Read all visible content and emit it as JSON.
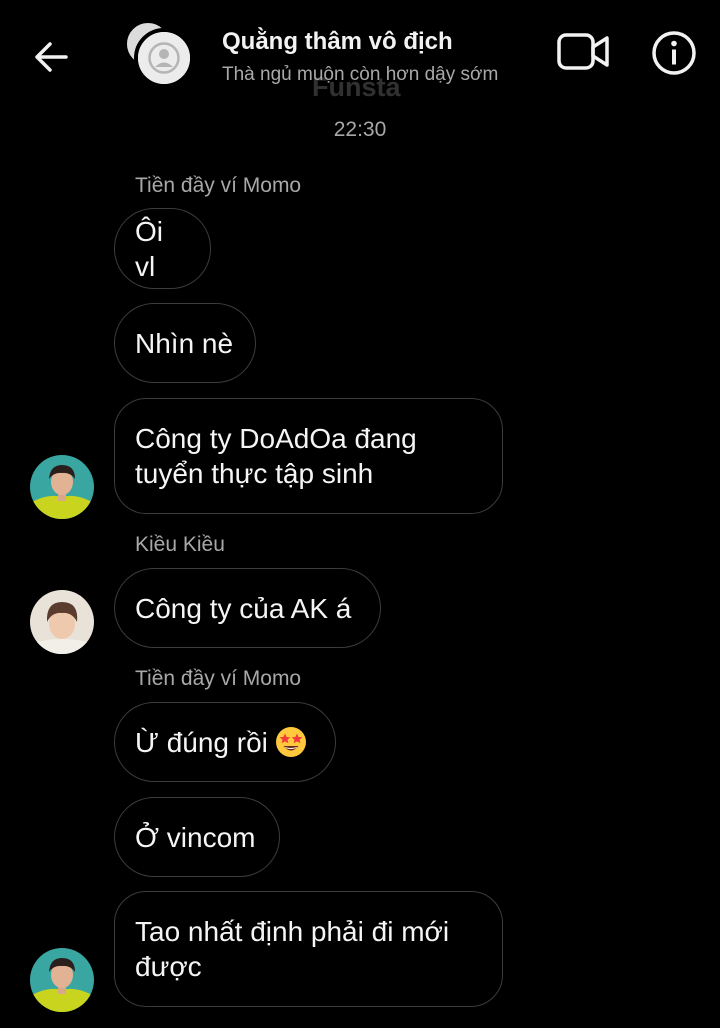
{
  "header": {
    "title": "Quằng thâm vô địch",
    "status": "Thà ngủ muộn còn hơn dậy sớm",
    "watermark": "Funsta",
    "back_icon": "arrow-left-icon",
    "video_icon": "video-camera-icon",
    "info_icon": "info-icon"
  },
  "timestamp": "22:30",
  "colors": {
    "background": "#000000",
    "bubble_border": "#3c3c3c",
    "secondary_text": "#a8a8a8",
    "primary_text": "#f5f5f5"
  },
  "messages": [
    {
      "sender": "Tiền đầy ví Momo",
      "text": "Ôi vl"
    },
    {
      "text": "Nhìn nè"
    },
    {
      "lines": [
        "Công ty DoAdOa đang",
        "tuyển thực tập sinh"
      ]
    },
    {
      "sender": "Kiều Kiều",
      "text": "Công ty của AK á"
    },
    {
      "sender": "Tiền đầy ví Momo",
      "text": "Ừ đúng rồi",
      "emoji": "star-struck-emoji"
    },
    {
      "text": "Ở vincom"
    },
    {
      "lines": [
        "Tao nhất định phải đi mới",
        "được"
      ]
    }
  ]
}
